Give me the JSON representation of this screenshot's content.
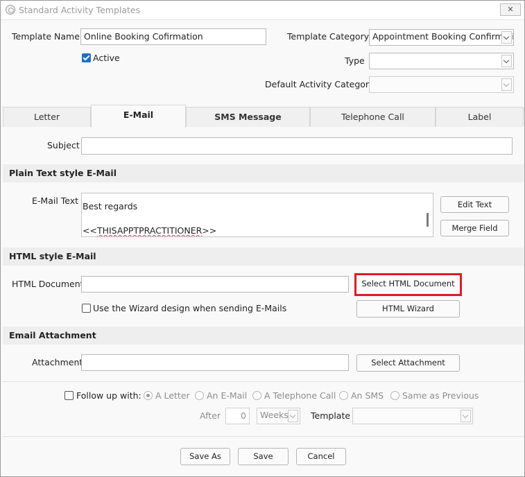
{
  "window": {
    "title": "Standard Activity Templates",
    "close_symbol": "✕"
  },
  "header": {
    "template_name_label": "Template Name",
    "template_name_value": "Online Booking Cofirmation",
    "active_label": "Active",
    "template_category_label": "Template Category",
    "template_category_value": "Appointment Booking Confirmation",
    "type_label": "Type",
    "type_value": "",
    "default_activity_category_label": "Default Activity Category",
    "default_activity_category_value": ""
  },
  "tabs": [
    {
      "label": "Letter"
    },
    {
      "label": "E-Mail"
    },
    {
      "label": "SMS Message"
    },
    {
      "label": "Telephone Call"
    },
    {
      "label": "Label"
    }
  ],
  "email": {
    "subject_label": "Subject",
    "subject_value": "",
    "plain_section_title": "Plain Text style E-Mail",
    "email_text_label": "E-Mail Text",
    "email_text_line1": "Best regards",
    "email_text_line2_prefix": "<<",
    "email_text_line2_word": "THISAPPTPRACTITIONER",
    "email_text_line2_suffix": ">>",
    "edit_text_button": "Edit Text",
    "merge_field_button": "Merge Field",
    "html_section_title": "HTML style E-Mail",
    "html_document_label": "HTML Document",
    "html_document_value": "",
    "select_html_button": "Select HTML Document",
    "wizard_checkbox_label": "Use the Wizard design when sending E-Mails",
    "html_wizard_button": "HTML Wizard",
    "attachment_section_title": "Email Attachment",
    "attachment_label": "Attachment",
    "attachment_value": "",
    "select_attachment_button": "Select Attachment"
  },
  "followup": {
    "checkbox_label": "Follow up with:",
    "options": [
      {
        "label": "A Letter",
        "selected": true
      },
      {
        "label": "An E-Mail",
        "selected": false
      },
      {
        "label": "A Telephone Call",
        "selected": false
      },
      {
        "label": "An SMS",
        "selected": false
      },
      {
        "label": "Same as Previous",
        "selected": false
      }
    ],
    "after_label": "After",
    "after_value": "0",
    "unit_value": "Weeks",
    "template_label": "Template",
    "template_value": ""
  },
  "footer": {
    "save_as_button": "Save As",
    "save_button": "Save",
    "cancel_button": "Cancel"
  },
  "colors": {
    "accent_checkbox": "#1e6fc1",
    "highlight_border": "#e01b24"
  }
}
